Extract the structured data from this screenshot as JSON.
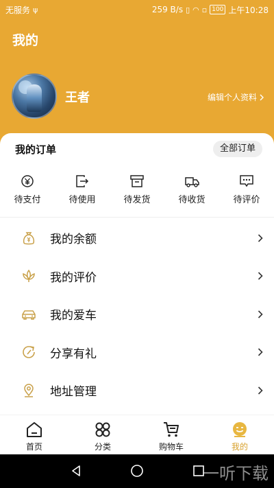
{
  "status_bar": {
    "carrier": "无服务",
    "usb_icon": "usb-icon",
    "speed": "259 B/s",
    "battery": "100",
    "time": "上午10:28"
  },
  "header": {
    "title": "我的",
    "username": "王者",
    "edit_profile": "编辑个人资料",
    "background_color": "#e8a833"
  },
  "orders": {
    "title": "我的订单",
    "all_orders": "全部订单",
    "items": [
      {
        "label": "待支付",
        "icon": "yen-circle-icon"
      },
      {
        "label": "待使用",
        "icon": "exit-box-icon"
      },
      {
        "label": "待发货",
        "icon": "box-icon"
      },
      {
        "label": "待收货",
        "icon": "truck-icon"
      },
      {
        "label": "待评价",
        "icon": "chat-bubble-icon"
      }
    ]
  },
  "menu": [
    {
      "label": "我的余额",
      "icon": "money-bag-icon"
    },
    {
      "label": "我的评价",
      "icon": "lotus-icon"
    },
    {
      "label": "我的爱车",
      "icon": "car-icon"
    },
    {
      "label": "分享有礼",
      "icon": "share-refresh-icon"
    },
    {
      "label": "地址管理",
      "icon": "location-pin-icon"
    }
  ],
  "tabbar": [
    {
      "label": "首页",
      "icon": "home-icon",
      "active": false
    },
    {
      "label": "分类",
      "icon": "category-icon",
      "active": false
    },
    {
      "label": "购物车",
      "icon": "cart-icon",
      "active": false
    },
    {
      "label": "我的",
      "icon": "profile-face-icon",
      "active": true
    }
  ],
  "navigation": {
    "watermark": "一听下载"
  },
  "colors": {
    "accent": "#e8a833",
    "icon_gold": "#c9a14a",
    "active_tab": "#d8a12c"
  }
}
